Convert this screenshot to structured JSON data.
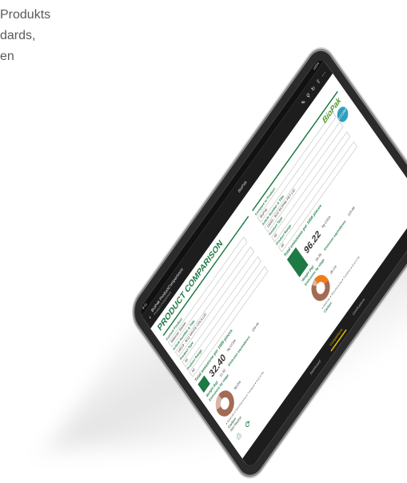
{
  "background_text": [
    "Produkts",
    "dards,",
    "en"
  ],
  "app": {
    "status_time": "9:41",
    "status_battery": "100%",
    "back_label": "‹",
    "report_title": "BioPak ProductComparisons",
    "report_subtitle": "Product Comparison",
    "center_label": "BioPak",
    "title": "PRODUCT COMPARISON"
  },
  "left": {
    "dropdowns": [
      {
        "label": "Current Product",
        "value": "Material: Sticker"
      },
      {
        "label": "Article Number & Title",
        "value": "10019 - 8OZ WHITE CPLA LID"
      },
      {
        "label": "Product Type",
        "value": "All"
      },
      {
        "label": "Product Range",
        "value": "All"
      }
    ],
    "section": "Total emissions per 1000 pieces",
    "weight_label": "Weight (kg)",
    "weight_value": "11.40",
    "total_value": "32.40",
    "total_unit": "kg CO2e",
    "emission_label": "Emission equivalence",
    "emission_value": "126.46",
    "donut_label": "Emissions by stage",
    "donut_pct": "80.0%",
    "legend": "● Materials ● Manufacturing ● Transport ● End of life",
    "carbon_label": "Carbon",
    "carbon_value": "Not Neutral"
  },
  "right": {
    "dropdowns": [
      {
        "label": "Compare to Product",
        "value": "BioPak"
      },
      {
        "label": "Article Number & Title",
        "value": "10020 - 8OZ BIOPAK PET LID"
      },
      {
        "label": "Product Type",
        "value": "All"
      },
      {
        "label": "Product Range",
        "value": "All"
      }
    ],
    "section": "Total emissions per 1000 pieces",
    "weight_label": "Weight (kg)",
    "weight_value": "28.39",
    "total_value": "96.22",
    "total_unit": "kg CO2e",
    "emission_label": "Emission equivalence",
    "emission_value": "103.88",
    "donut_label": "Emissions by stage",
    "donut_pct": "28.1%",
    "legend": "● Materials ● Manufacturing ● Transport ● End of life",
    "carbon_label": "Carbon",
    "logo": "BioPak",
    "badge": "B CORP"
  },
  "tabs": [
    "Dashboard",
    "Comparisons",
    "Certifications"
  ],
  "colors": {
    "brand_green": "#1e7a45",
    "donut_brown": "#a26b54",
    "donut_orange": "#f07c1a",
    "tab_active": "#e8c100"
  }
}
